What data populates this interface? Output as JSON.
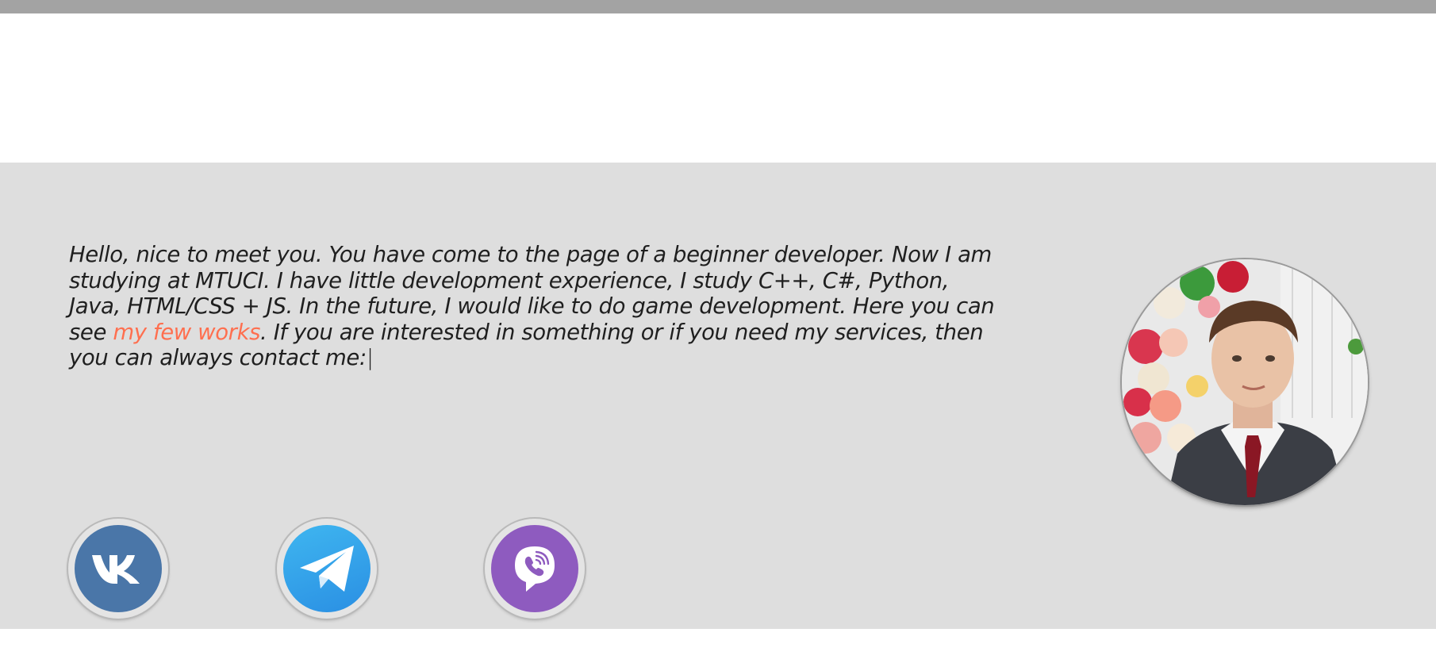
{
  "bio": {
    "text_before": "Hello, nice to meet you. You have come to the page of a beginner developer. Now I am studying at MTUCI. I have little development experience, I study C++, C#, Python, Java, HTML/CSS + JS. In the future, I would like to do game development. Here you can see ",
    "link_text": "my few works",
    "text_after": ". If you are interested in something or if you need my services, then you can always contact me:",
    "caret": "|"
  },
  "avatar": {
    "icon": "profile-photo"
  },
  "social": [
    {
      "name": "VK",
      "icon": "vk-icon",
      "color": "#4a76a8"
    },
    {
      "name": "Telegram",
      "icon": "telegram-icon",
      "color": "#2a9be6"
    },
    {
      "name": "Viber",
      "icon": "viber-icon",
      "color": "#8e5bbf"
    }
  ],
  "colors": {
    "topbar": "#a3a3a3",
    "hero_background": "#dedede",
    "link_accent": "#ff6f4f",
    "text": "#1f1f1f"
  }
}
